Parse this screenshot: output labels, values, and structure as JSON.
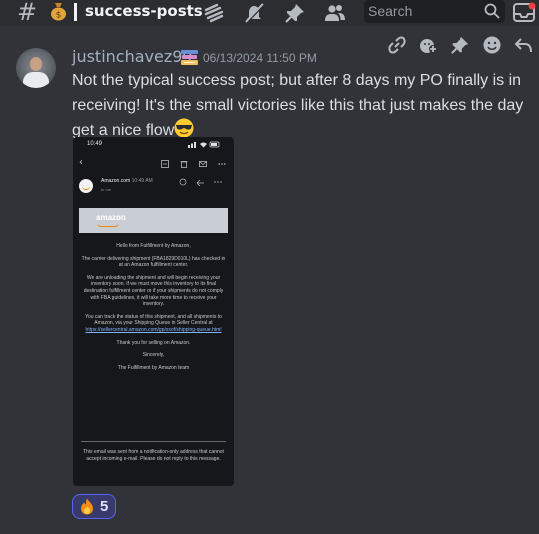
{
  "header": {
    "hash_symbol": "#",
    "channel_emoji": "money-bag-icon",
    "channel_name": "success-posts",
    "icons": [
      "threads-icon",
      "mute-bell-icon",
      "pin-icon",
      "members-icon"
    ],
    "search_placeholder": "Search",
    "inbox_icon": "inbox-icon"
  },
  "toolbar": {
    "actions": [
      "copy-link-icon",
      "add-reaction-icon",
      "pin-icon",
      "emoji-icon",
      "reply-icon"
    ]
  },
  "message": {
    "username": "justinchavez99",
    "role_icon": "books-icon",
    "timestamp": "06/13/2024 11:50 PM",
    "text": "Not the typical success post; but after 8 days my PO finally is in receiving! It's the small victories like this that just makes the day get a nice flow",
    "trailing_emoji": "sunglasses-emoji"
  },
  "attachment": {
    "status_time": "10:49",
    "sender": "Amazon.com",
    "sender_time": "10:49 AM",
    "to_me": "to me",
    "banner_logo": "amazon",
    "paragraphs": [
      "Hello from Fulfillment by Amazon,",
      "The carrier delivering shipment (FBA1829D010L) has checked in at an Amazon fulfillment center.",
      "We are unloading the shipment and will begin receiving your inventory soon. If we must move this inventory to its final destination fulfillment center or if your shipments do not comply with FBA guidelines, it will take more time to receive your inventory.",
      "You can track the status of this shipment, and all shipments to Amazon, via your Shipping Queue in Seller Central at",
      "Thank you for selling on Amazon.",
      "Sincerely,",
      "The Fulfillment by Amazon team"
    ],
    "link": "https://sellercentral.amazon.com/gp/ssof/shipping-queue.html",
    "footer": "This email was sent from a notification-only address that cannot accept incoming e-mail. Please do not reply to this message."
  },
  "reaction": {
    "emoji": "fire-emoji",
    "count": "5"
  },
  "colors": {
    "background": "#313338",
    "header": "#2b2d31",
    "username": "#a3b0be",
    "reaction_border": "#5865f2",
    "reaction_bg": "#373a6a"
  }
}
